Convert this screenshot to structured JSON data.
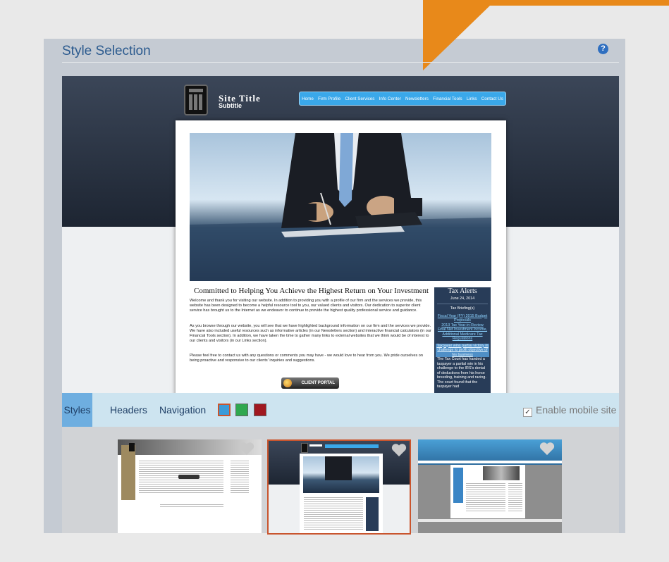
{
  "panel": {
    "title": "Style Selection",
    "help_glyph": "?"
  },
  "preview": {
    "site_title": "Site Title",
    "site_subtitle": "Subtitle",
    "nav": [
      "Home",
      "Firm Profile",
      "Client Services",
      "Info Center",
      "Newsletters",
      "Financial Tools",
      "Links",
      "Contact Us"
    ],
    "headline": "Committed to Helping You Achieve the Highest Return on Your Investment",
    "paragraphs": [
      "Welcome and thank you for visiting our website. In addition to providing you with a profile of our firm and the services we provide, this website has been designed to become a helpful resource tool to you, our valued clients and visitors. Our dedication to superior client service has brought us to the Internet as we endeavor to continue to provide the highest quality professional service and guidance.",
      "As you browse through our website, you will see that we have highlighted background information on our firm and the services we provide. We have also included useful resources such as informative articles (in our Newsletters section) and interactive financial calculators (in our Financial Tools section). In addition, we have taken the time to gather many links to external websites that we think would be of interest to our clients and visitors (in our Links section).",
      "Please feel free to contact us with any questions or comments you may have - we would love to hear from you. We pride ourselves on being proactive and responsive to our clients' inquiries and suggestions."
    ],
    "portal_button": "CLIENT PORTAL",
    "alerts": {
      "title": "Tax Alerts",
      "date": "June 24, 2014",
      "subhead": "Tax Briefing(s)",
      "links": [
        "Fiscal Year (FY) 2015 Budget Proposals",
        "2013 Tax Year-in-Review",
        "Final Net Investment Income, Additional Medicare Tax Regulations"
      ],
      "highlight": "Taxpayer wins partial victory in challenge to profit objective of his business",
      "body": "The Tax Court has handed a taxpayer a partial win in his challenge to the IRS's denial of deductions from his horse breeding, training and racing. The court found that the taxpayer had"
    }
  },
  "tabs": [
    {
      "label": "Styles",
      "active": true
    },
    {
      "label": "Headers",
      "active": false
    },
    {
      "label": "Navigation",
      "active": false
    }
  ],
  "swatches": [
    {
      "name": "blue",
      "color": "#3a9bd9",
      "selected": true
    },
    {
      "name": "green",
      "color": "#2fa84f",
      "selected": false
    },
    {
      "name": "red",
      "color": "#a01820",
      "selected": false
    }
  ],
  "mobile": {
    "label": "Enable mobile site",
    "checked": true
  },
  "thumbnails": [
    {
      "name": "style-1",
      "selected": false
    },
    {
      "name": "style-2",
      "selected": true
    },
    {
      "name": "style-3",
      "selected": false
    }
  ],
  "colors": {
    "accent": "#2b5a8e",
    "orange": "#e8891a",
    "selected_border": "#c9552e"
  }
}
